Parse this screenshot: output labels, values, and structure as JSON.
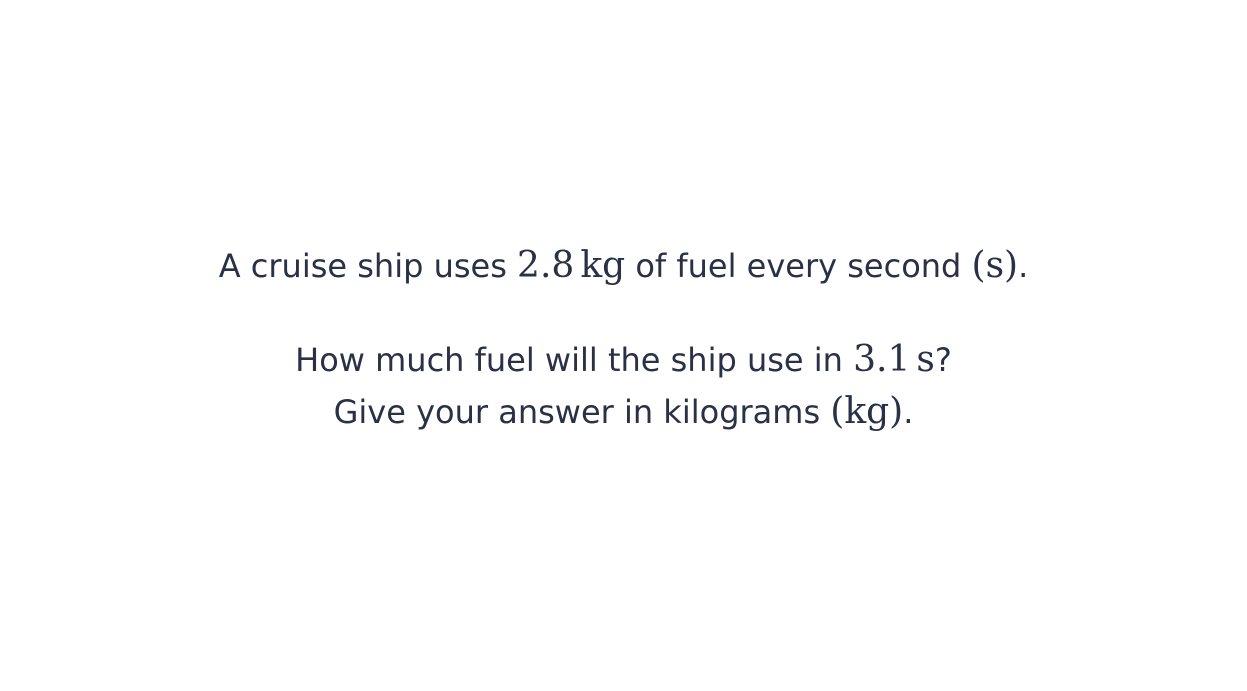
{
  "problem": {
    "line1": {
      "pre": "A cruise ship uses ",
      "rate_value": "2.8",
      "rate_unit": "kg",
      "mid": " of fuel every second ",
      "time_unit_paren": "(s)",
      "end": "."
    },
    "line2": {
      "pre": "How much fuel will the ship use in ",
      "time_value": "3.1",
      "time_unit": "s",
      "end": "?"
    },
    "line3": {
      "pre": "Give your answer in kilograms ",
      "unit_paren": "(kg)",
      "end": "."
    }
  }
}
